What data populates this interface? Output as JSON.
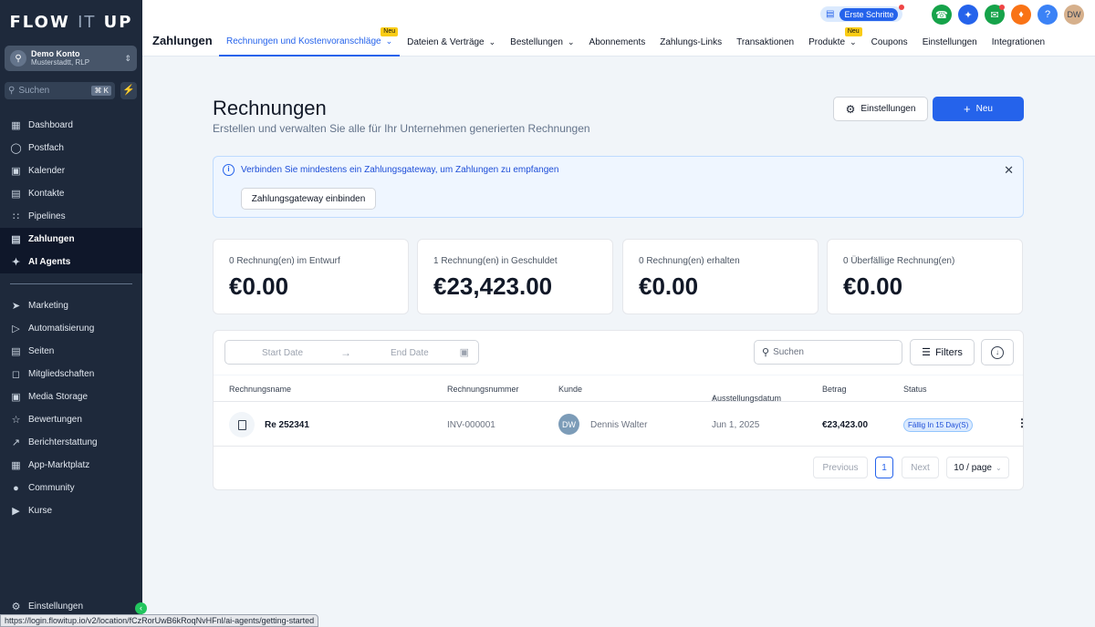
{
  "sidebar": {
    "logo": {
      "left": "FLOW",
      "mid": "IT",
      "right": "UP"
    },
    "account": {
      "name": "Demo Konto",
      "location": "Musterstadtt, RLP"
    },
    "search": {
      "placeholder": "Suchen",
      "shortcut": "⌘ K"
    },
    "items": [
      {
        "label": "Dashboard",
        "icon": "dashboard-icon"
      },
      {
        "label": "Postfach",
        "icon": "chat-icon"
      },
      {
        "label": "Kalender",
        "icon": "calendar-icon"
      },
      {
        "label": "Kontakte",
        "icon": "contacts-icon"
      },
      {
        "label": "Pipelines",
        "icon": "pipelines-icon"
      },
      {
        "label": "Zahlungen",
        "icon": "payments-icon",
        "active": true
      },
      {
        "label": "AI Agents",
        "icon": "sparkle-icon"
      },
      {
        "label": "Marketing",
        "icon": "send-icon"
      },
      {
        "label": "Automatisierung",
        "icon": "automation-icon"
      },
      {
        "label": "Seiten",
        "icon": "pages-icon"
      },
      {
        "label": "Mitgliedschaften",
        "icon": "membership-icon"
      },
      {
        "label": "Media Storage",
        "icon": "image-icon"
      },
      {
        "label": "Bewertungen",
        "icon": "star-icon"
      },
      {
        "label": "Berichterstattung",
        "icon": "trend-icon"
      },
      {
        "label": "App-Marktplatz",
        "icon": "grid-icon"
      },
      {
        "label": "Community",
        "icon": "people-icon"
      },
      {
        "label": "Kurse",
        "icon": "video-icon"
      }
    ],
    "settings": "Einstellungen",
    "status_url": "https://login.flowitup.io/v2/location/fCzRorUwB6kRoqNvHFnl/ai-agents/getting-started"
  },
  "topbar": {
    "title": "Zahlungen",
    "first_steps": "Erste Schritte",
    "avatar": "DW",
    "tabs": [
      {
        "label": "Rechnungen und Kostenvoranschläge",
        "dropdown": true,
        "badge": "Neu",
        "active": true
      },
      {
        "label": "Dateien & Verträge",
        "dropdown": true
      },
      {
        "label": "Bestellungen",
        "dropdown": true
      },
      {
        "label": "Abonnements"
      },
      {
        "label": "Zahlungs-Links"
      },
      {
        "label": "Transaktionen"
      },
      {
        "label": "Produkte",
        "dropdown": true,
        "badge": "Neu"
      },
      {
        "label": "Coupons"
      },
      {
        "label": "Einstellungen"
      },
      {
        "label": "Integrationen"
      }
    ],
    "actions": [
      {
        "name": "phone-icon",
        "color": "#16a34a"
      },
      {
        "name": "magic-icon",
        "color": "#2563eb"
      },
      {
        "name": "megaphone-icon",
        "color": "#16a34a"
      },
      {
        "name": "bell-icon",
        "color": "#f97316"
      },
      {
        "name": "help-icon",
        "color": "#3b82f6"
      }
    ]
  },
  "main": {
    "title": "Rechnungen",
    "subtitle": "Erstellen und verwalten Sie alle für Ihr Unternehmen generierten Rechnungen",
    "settings_button": "Einstellungen",
    "new_button": "Neu",
    "alert": {
      "text": "Verbinden Sie mindestens ein Zahlungsgateway, um Zahlungen zu empfangen",
      "button": "Zahlungsgateway einbinden"
    },
    "stats": [
      {
        "label": "0 Rechnung(en) im Entwurf",
        "value": "€0.00"
      },
      {
        "label": "1 Rechnung(en) in Geschuldet",
        "value": "€23,423.00"
      },
      {
        "label": "0 Rechnung(en) erhalten",
        "value": "€0.00"
      },
      {
        "label": "0 Überfällige Rechnung(en)",
        "value": "€0.00"
      }
    ],
    "table": {
      "start_date": "Start Date",
      "end_date": "End Date",
      "search_placeholder": "Suchen",
      "filters": "Filters",
      "columns": {
        "name": "Rechnungsname",
        "number": "Rechnungsnummer",
        "customer": "Kunde",
        "date": "Ausstellungsdatum",
        "amount": "Betrag",
        "status": "Status"
      },
      "rows": [
        {
          "name": "Re 252341",
          "number": "INV-000001",
          "customer_initials": "DW",
          "customer": "Dennis Walter",
          "date": "Jun 1, 2025",
          "amount": "€23,423.00",
          "status": "Fällig In 15 Day(S)"
        }
      ],
      "pagination": {
        "previous": "Previous",
        "page": "1",
        "next": "Next",
        "per_page": "10 / page"
      }
    }
  }
}
